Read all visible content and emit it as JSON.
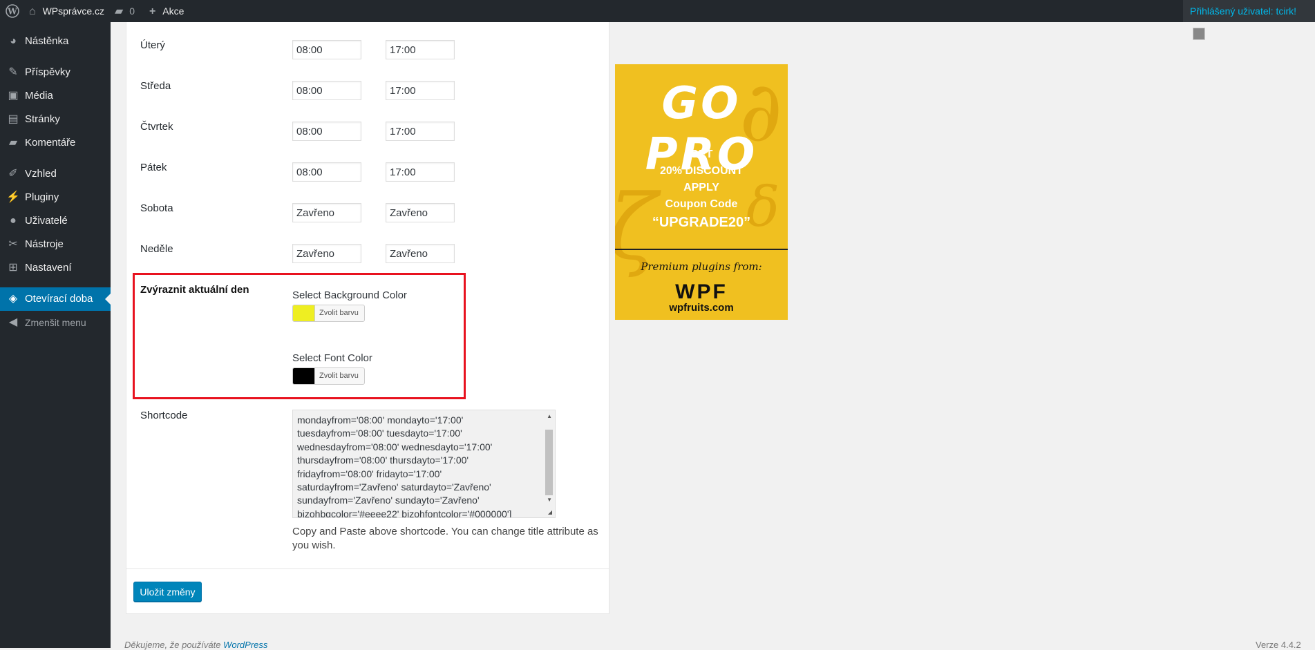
{
  "adminbar": {
    "site_name": "WPsprávce.cz",
    "comments_count": "0",
    "new_label": "Akce",
    "user_label": "Přihlášený uživatel: tcirk!"
  },
  "sidebar": {
    "items": [
      {
        "label": "Nástěnka",
        "icon": "dashboard-icon"
      },
      {
        "label": "Příspěvky",
        "icon": "pin-icon"
      },
      {
        "label": "Média",
        "icon": "media-icon"
      },
      {
        "label": "Stránky",
        "icon": "pages-icon"
      },
      {
        "label": "Komentáře",
        "icon": "comments-icon"
      },
      {
        "label": "Vzhled",
        "icon": "appearance-icon"
      },
      {
        "label": "Pluginy",
        "icon": "plugins-icon"
      },
      {
        "label": "Uživatelé",
        "icon": "users-icon"
      },
      {
        "label": "Nástroje",
        "icon": "tools-icon"
      },
      {
        "label": "Nastavení",
        "icon": "settings-icon"
      },
      {
        "label": "Otevírací doba",
        "icon": "clock-icon",
        "active": true
      },
      {
        "label": "Zmenšit menu",
        "icon": "collapse-icon"
      }
    ]
  },
  "hours": {
    "rows": [
      {
        "day": "Úterý",
        "from": "08:00",
        "to": "17:00"
      },
      {
        "day": "Středa",
        "from": "08:00",
        "to": "17:00"
      },
      {
        "day": "Čtvrtek",
        "from": "08:00",
        "to": "17:00"
      },
      {
        "day": "Pátek",
        "from": "08:00",
        "to": "17:00"
      },
      {
        "day": "Sobota",
        "from": "Zavřeno",
        "to": "Zavřeno"
      },
      {
        "day": "Neděle",
        "from": "Zavřeno",
        "to": "Zavřeno"
      }
    ]
  },
  "highlight": {
    "label": "Zvýraznit aktuální den",
    "bg_label": "Select Background Color",
    "bg_color": "#eeee22",
    "font_label": "Select Font Color",
    "font_color": "#000000",
    "picker_button": "Zvolit barvu"
  },
  "shortcode": {
    "label": "Shortcode",
    "value": "mondayfrom='08:00' mondayto='17:00' tuesdayfrom='08:00' tuesdayto='17:00' wednesdayfrom='08:00' wednesdayto='17:00' thursdayfrom='08:00' thursdayto='17:00' fridayfrom='08:00' fridayto='17:00' saturdayfrom='Zavřeno' saturdayto='Zavřeno' sundayfrom='Zavřeno' sundayto='Zavřeno' bizohbgcolor='#eeee22' bizohfontcolor='#000000']",
    "help": "Copy and Paste above shortcode. You can change title attribute as you wish."
  },
  "save_label": "Uložit změny",
  "footer": {
    "thanks_prefix": "Děkujeme, že používáte",
    "thanks_link": "WordPress",
    "version": "Verze 4.4.2"
  },
  "promo": {
    "headline": "GO PRO",
    "line1": "GET",
    "line2": "20% DISCOUNT",
    "line3": "APPLY",
    "line4": "Coupon Code",
    "code": "“UPGRADE20”",
    "premium": "Premium plugins from:",
    "brand": "WPF",
    "domain": "wpfruits.com",
    "bg_color": "#f0c020"
  }
}
